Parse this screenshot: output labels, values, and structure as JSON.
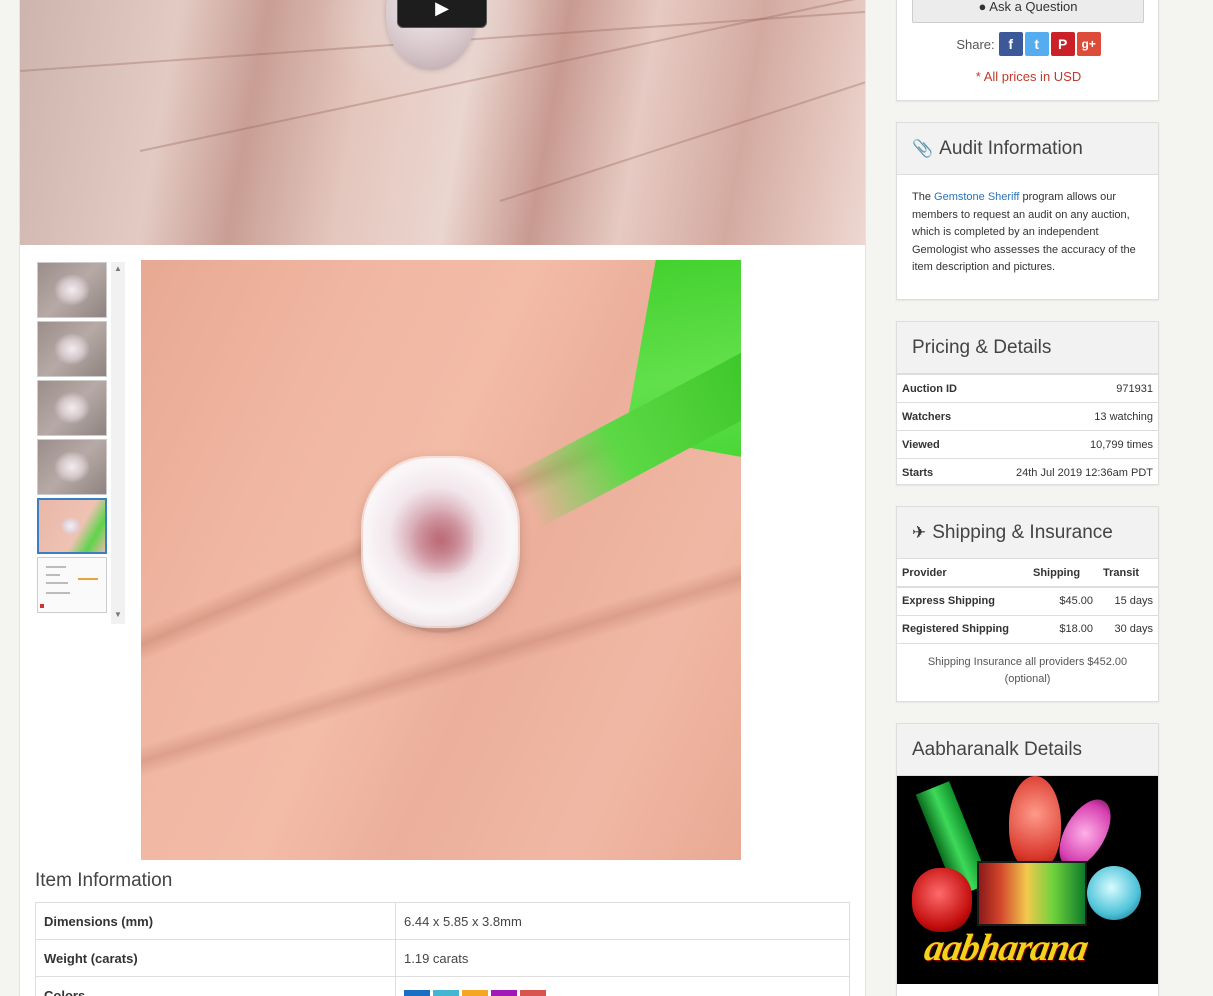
{
  "video": {
    "play_icon": "play-icon"
  },
  "gallery": {
    "thumbnails": [
      {
        "kind": "gem"
      },
      {
        "kind": "gem"
      },
      {
        "kind": "gem"
      },
      {
        "kind": "gem"
      },
      {
        "kind": "gem-on-finger",
        "selected": true
      },
      {
        "kind": "certificate"
      }
    ],
    "scroll_up": "▲",
    "scroll_down": "▼"
  },
  "item_info": {
    "title": "Item Information",
    "rows": [
      {
        "label": "Dimensions (mm)",
        "value": "6.44 x 5.85 x 3.8mm"
      },
      {
        "label": "Weight (carats)",
        "value": "1.19 carats"
      },
      {
        "label": "Colors",
        "value": ""
      }
    ],
    "color_swatches": [
      "#1a6fc4",
      "#45b6d1",
      "#f5a623",
      "#a217b8",
      "#d9534f"
    ]
  },
  "actions": {
    "ask_question": "Ask a Question",
    "share_label": "Share:",
    "share": [
      {
        "name": "facebook",
        "glyph": "f",
        "color": "#3b5998"
      },
      {
        "name": "twitter",
        "glyph": "t",
        "color": "#55acee"
      },
      {
        "name": "pinterest",
        "glyph": "P",
        "color": "#cb2027"
      },
      {
        "name": "google-plus",
        "glyph": "g+",
        "color": "#dd4b39"
      }
    ],
    "prices_note": "* All prices in USD"
  },
  "audit": {
    "title": "Audit Information",
    "text_prefix": "The ",
    "link": "Gemstone Sheriff",
    "text_suffix": " program allows our members to request an audit on any auction, which is completed by an independent Gemologist who assesses the accuracy of the item description and pictures."
  },
  "pricing": {
    "title": "Pricing & Details",
    "rows": [
      {
        "label": "Auction ID",
        "value": "971931"
      },
      {
        "label": "Watchers",
        "value": "13 watching"
      },
      {
        "label": "Viewed",
        "value": "10,799 times"
      },
      {
        "label": "Starts",
        "value": "24th Jul 2019 12:36am PDT"
      }
    ]
  },
  "shipping": {
    "title": "Shipping & Insurance",
    "headers": {
      "provider": "Provider",
      "shipping": "Shipping",
      "transit": "Transit"
    },
    "rows": [
      {
        "provider": "Express Shipping",
        "shipping": "$45.00",
        "transit": "15 days"
      },
      {
        "provider": "Registered Shipping",
        "shipping": "$18.00",
        "transit": "30 days"
      }
    ],
    "note": "Shipping Insurance all providers $452.00 (optional)"
  },
  "seller": {
    "title": "Aabharanalk Details",
    "brand": "aabharana"
  },
  "colors": {
    "accent": "#2a73b8",
    "warning": "#c0392b"
  }
}
